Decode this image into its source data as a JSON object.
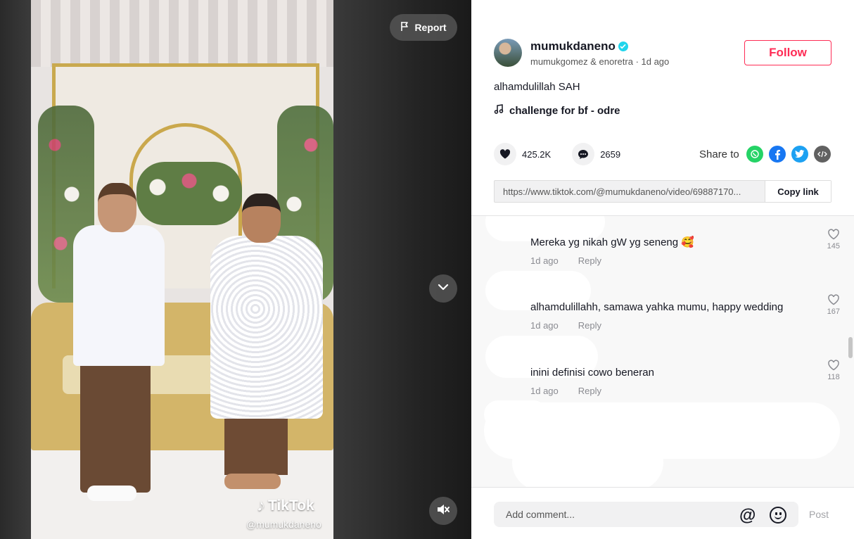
{
  "video": {
    "report_label": "Report",
    "watermark_brand": "TikTok",
    "watermark_handle": "@mumukdaneno"
  },
  "author": {
    "username": "mumukdaneno",
    "subtitle": "mumukgomez & enoretra · 1d ago",
    "verified": true,
    "follow_label": "Follow"
  },
  "post": {
    "caption": "alhamdulillah SAH",
    "music": "challenge for bf - odre",
    "likes": "425.2K",
    "comments": "2659",
    "share_label": "Share to",
    "link": "https://www.tiktok.com/@mumukdaneno/video/69887170...",
    "copy_label": "Copy link"
  },
  "comments": [
    {
      "text": "Mereka yg nikah gW yg seneng 🥰",
      "time": "1d ago",
      "reply": "Reply",
      "likes": "145"
    },
    {
      "text": "alhamdulillahh, samawa yahka mumu, happy wedding",
      "time": "1d ago",
      "reply": "Reply",
      "likes": "167"
    },
    {
      "text": "inini definisi cowo beneran",
      "time": "1d ago",
      "reply": "Reply",
      "likes": "118"
    }
  ],
  "compose": {
    "placeholder": "Add comment...",
    "post_label": "Post"
  },
  "colors": {
    "accent": "#fe2c55",
    "verified": "#20d5ec",
    "whatsapp": "#25d366",
    "facebook": "#1877f2",
    "twitter": "#1da1f2",
    "embed": "#616161"
  }
}
